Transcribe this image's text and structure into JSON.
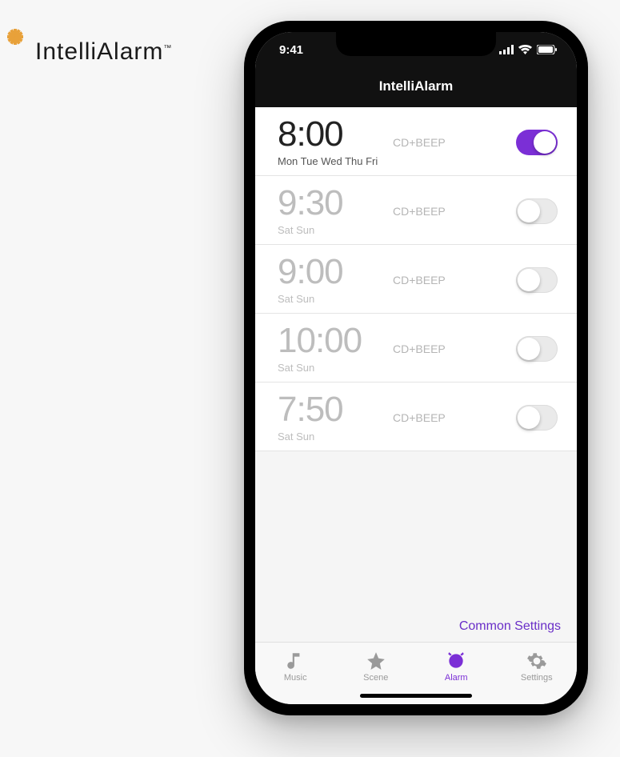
{
  "brand": {
    "name": "IntelliAlarm",
    "tm": "™"
  },
  "status": {
    "time": "9:41"
  },
  "header": {
    "title": "IntelliAlarm"
  },
  "alarms": [
    {
      "time": "8:00",
      "days": "Mon Tue Wed Thu Fri",
      "sound": "CD+BEEP",
      "on": true
    },
    {
      "time": "9:30",
      "days": "Sat Sun",
      "sound": "CD+BEEP",
      "on": false
    },
    {
      "time": "9:00",
      "days": "Sat Sun",
      "sound": "CD+BEEP",
      "on": false
    },
    {
      "time": "10:00",
      "days": "Sat Sun",
      "sound": "CD+BEEP",
      "on": false
    },
    {
      "time": "7:50",
      "days": "Sat Sun",
      "sound": "CD+BEEP",
      "on": false
    }
  ],
  "commonSettings": {
    "label": "Common Settings"
  },
  "tabs": [
    {
      "id": "music",
      "label": "Music",
      "active": false
    },
    {
      "id": "scene",
      "label": "Scene",
      "active": false
    },
    {
      "id": "alarm",
      "label": "Alarm",
      "active": true
    },
    {
      "id": "settings",
      "label": "Settings",
      "active": false
    }
  ],
  "colors": {
    "accent": "#7b2fd6"
  }
}
